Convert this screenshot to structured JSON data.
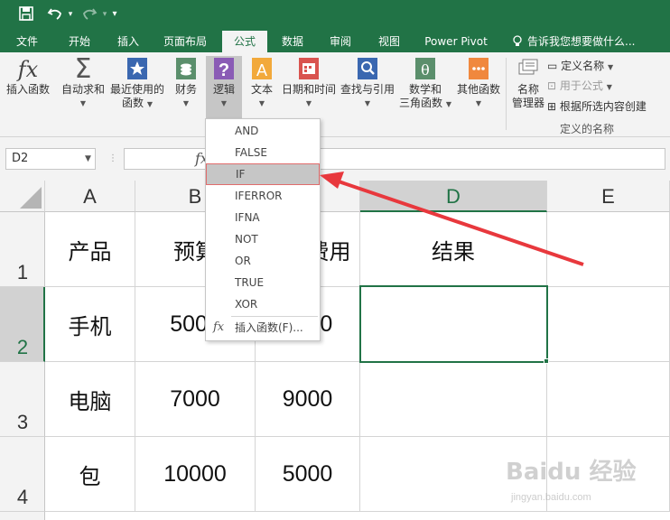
{
  "title_bar": {
    "save_icon": "save-icon",
    "undo_icon": "undo-icon",
    "redo_icon": "redo-icon",
    "customize_icon": "customize-qat-icon"
  },
  "tabs": [
    "文件",
    "开始",
    "插入",
    "页面布局",
    "公式",
    "数据",
    "审阅",
    "视图",
    "Power Pivot"
  ],
  "active_tab": "公式",
  "tell_me": {
    "icon": "lightbulb-icon",
    "text": "告诉我您想要做什么..."
  },
  "ribbon": {
    "insert_function": "插入函数",
    "autosum": "自动求和",
    "recent_line1": "最近使用的",
    "recent_line2": "函数",
    "financial": "财务",
    "logical": "逻辑",
    "text": "文本",
    "datetime": "日期和时间",
    "lookup": "查找与引用",
    "math_line1": "数学和",
    "math_line2": "三角函数",
    "other": "其他函数",
    "name_manager_line1": "名称",
    "name_manager_line2": "管理器",
    "define_name": "定义名称",
    "use_in_formula": "用于公式",
    "create_from_selection": "根据所选内容创建",
    "group_defined_names": "定义的名称"
  },
  "formula_bar": {
    "name_box": "D2",
    "cancel": "✕",
    "enter": "✓",
    "fx": "fx",
    "formula": ""
  },
  "columns": [
    "A",
    "B",
    "C",
    "D",
    "E"
  ],
  "rows": [
    "1",
    "2",
    "3",
    "4"
  ],
  "cells": {
    "A1": "产品",
    "B1": "预算",
    "C1": "实际费用",
    "D1": "结果",
    "A2": "手机",
    "B2": "5000",
    "C2": "8000",
    "A3": "电脑",
    "B3": "7000",
    "C3": "9000",
    "A4": "包",
    "B4": "10000",
    "C4": "5000"
  },
  "selected_cell": "D2",
  "dropdown": {
    "items": [
      "AND",
      "FALSE",
      "IF",
      "IFERROR",
      "IFNA",
      "NOT",
      "OR",
      "TRUE",
      "XOR"
    ],
    "highlighted": "IF",
    "insert_function": "插入函数(F)..."
  },
  "colors": {
    "excel_green": "#217346",
    "arrow_red": "#e8383d",
    "highlight_border": "#e06c6c"
  },
  "watermark": {
    "brand": "Baidu 经验",
    "url": "jingyan.baidu.com"
  }
}
